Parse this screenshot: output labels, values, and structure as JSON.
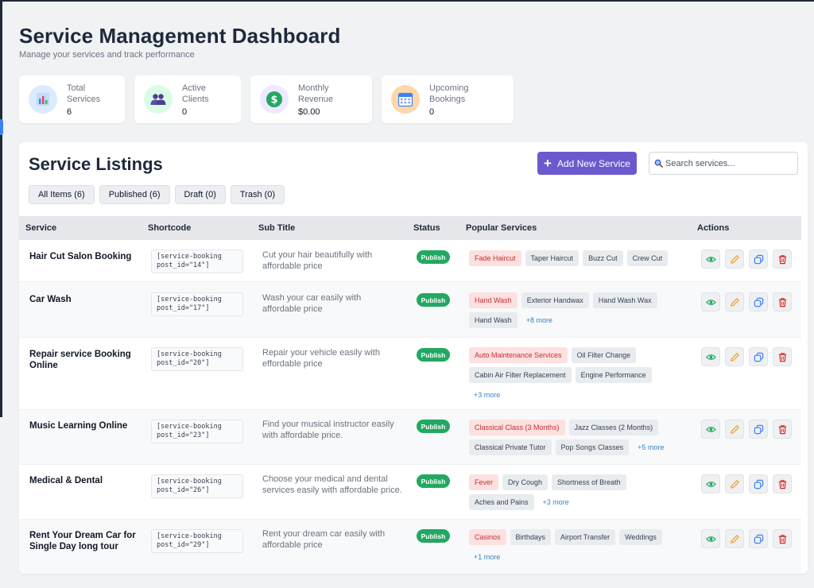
{
  "header": {
    "title": "Service Management Dashboard",
    "subtitle": "Manage your services and track performance"
  },
  "stats": [
    {
      "label": "Total Services",
      "value": "6",
      "icon": "bar-chart-icon",
      "color": "#dbeafe"
    },
    {
      "label": "Active Clients",
      "value": "0",
      "icon": "users-icon",
      "color": "#dcfce7"
    },
    {
      "label": "Monthly Revenue",
      "value": "$0.00",
      "icon": "dollar-icon",
      "color": "#ede9fe"
    },
    {
      "label": "Upcoming Bookings",
      "value": "0",
      "icon": "calendar-icon",
      "color": "#fed7aa"
    }
  ],
  "listing": {
    "title": "Service Listings",
    "add_button": "Add New Service",
    "search_placeholder": "Search services..."
  },
  "filters": [
    "All Items (6)",
    "Published (6)",
    "Draft (0)",
    "Trash (0)"
  ],
  "columns": [
    "Service",
    "Shortcode",
    "Sub Title",
    "Status",
    "Popular Services",
    "Actions"
  ],
  "rows": [
    {
      "name": "Hair Cut Salon Booking",
      "shortcode": "[service-booking\npost_id=\"14\"]",
      "subtitle": "Cut your hair beautifully with affordable price",
      "status": "Publish",
      "tags": [
        "Fade Haircut",
        "Taper Haircut",
        "Buzz Cut",
        "Crew Cut"
      ],
      "more": ""
    },
    {
      "name": "Car Wash",
      "shortcode": "[service-booking\npost_id=\"17\"]",
      "subtitle": "Wash your car easily with affordable price",
      "status": "Publish",
      "tags": [
        "Hand Wash",
        "Exterior Handwax",
        "Hand Wash Wax",
        "Hand Wash"
      ],
      "more": "+8 more"
    },
    {
      "name": "Repair service Booking Online",
      "shortcode": "[service-booking\npost_id=\"20\"]",
      "subtitle": "Repair your vehicle easily with effordable price",
      "status": "Publish",
      "tags": [
        "Auto Maintenance Services",
        "Oil Filter Change",
        "Cabin Air Filter Replacement",
        "Engine Performance"
      ],
      "more": "+3 more"
    },
    {
      "name": "Music Learning Online",
      "shortcode": "[service-booking\npost_id=\"23\"]",
      "subtitle": "Find your musical instructor easily with affordable price.",
      "status": "Publish",
      "tags": [
        "Classical Class (3 Months)",
        "Jazz Classes (2 Months)",
        "Classical Private Tutor",
        "Pop Songs Classes"
      ],
      "more": "+5 more"
    },
    {
      "name": "Medical & Dental",
      "shortcode": "[service-booking\npost_id=\"26\"]",
      "subtitle": "Choose your medical and dental services easily with affordable price.",
      "status": "Publish",
      "tags": [
        "Fever",
        "Dry Cough",
        "Shortness of Breath",
        "Aches and Pains"
      ],
      "more": "+3 more"
    },
    {
      "name": "Rent Your Dream Car for Single Day long tour",
      "shortcode": "[service-booking\npost_id=\"29\"]",
      "subtitle": "Rent your dream car easily with affordable price",
      "status": "Publish",
      "tags": [
        "Casinos",
        "Birthdays",
        "Airport Transfer",
        "Weddings"
      ],
      "more": "+1 more"
    }
  ],
  "action_icons": [
    "eye-icon",
    "pencil-icon",
    "duplicate-icon",
    "trash-icon"
  ],
  "colors": {
    "accent": "#6a5acd",
    "status_publish": "#22a861",
    "tag_highlight_bg": "#fde0e0",
    "tag_highlight_text": "#c53030",
    "more_link": "#3b82c4"
  }
}
